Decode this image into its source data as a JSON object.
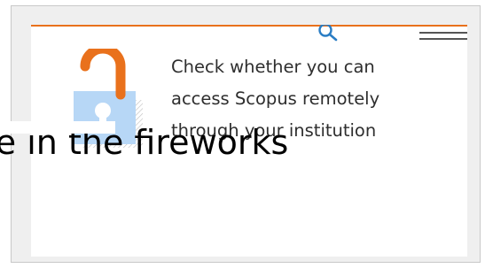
{
  "colors": {
    "accent": "#e9711c",
    "search": "#2a7dc4",
    "lock_body": "#b7d7f6",
    "text": "#2e2e2e"
  },
  "icons": {
    "search": "search-icon",
    "menu": "menu-icon",
    "lock": "unlocked-padlock-icon"
  },
  "message": {
    "line1": "Check whether you can",
    "line2": "access Scopus remotely",
    "line3": "through your institution"
  },
  "overlay": {
    "banner_text": "re in the fireworks"
  }
}
